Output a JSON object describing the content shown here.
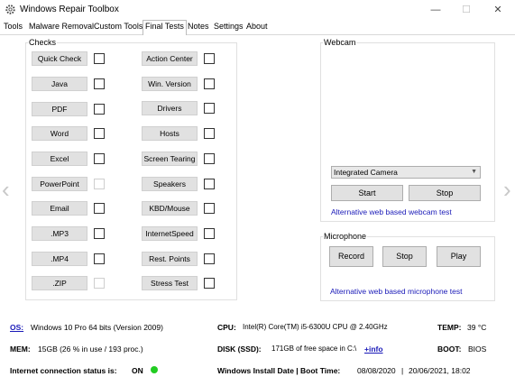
{
  "window": {
    "title": "Windows Repair Toolbox"
  },
  "tabs": [
    "Tools",
    "Malware Removal",
    "Custom Tools",
    "Final Tests",
    "Notes",
    "Settings",
    "About"
  ],
  "checks": {
    "label": "Checks",
    "left": [
      "Quick Check",
      "Java",
      "PDF",
      "Word",
      "Excel",
      "PowerPoint",
      "Email",
      ".MP3",
      ".MP4",
      ".ZIP"
    ],
    "right": [
      "Action Center",
      "Win. Version",
      "Drivers",
      "Hosts",
      "Screen Tearing",
      "Speakers",
      "KBD/Mouse",
      "InternetSpeed",
      "Rest. Points",
      "Stress Test"
    ]
  },
  "webcam": {
    "label": "Webcam",
    "device": "Integrated Camera",
    "start": "Start",
    "stop": "Stop",
    "link": "Alternative web based webcam test"
  },
  "microphone": {
    "label": "Microphone",
    "record": "Record",
    "stop": "Stop",
    "play": "Play",
    "link": "Alternative web based microphone test"
  },
  "sysinfo": {
    "os_label": "OS:",
    "os_value": "Windows 10 Pro 64 bits (Version 2009)",
    "cpu_label": "CPU:",
    "cpu_value": "Intel(R) Core(TM) i5-6300U CPU @ 2.40GHz",
    "temp_label": "TEMP:",
    "temp_value": "39 °C",
    "mem_label": "MEM:",
    "mem_value": "15GB  (26 % in use / 193 proc.)",
    "disk_label": "DISK (SSD):",
    "disk_value": "171GB of free space in C:\\",
    "disk_link": "+info",
    "boot_label": "BOOT:",
    "boot_value": "BIOS",
    "net_label": "Internet connection status is:",
    "net_value": "ON",
    "install_label": "Windows Install Date | Boot Time:",
    "install_value": "08/08/2020",
    "boot_time": "20/06/2021, 18:02"
  },
  "colors": {
    "status_on": "#22cc22",
    "link": "#1a1ab8"
  }
}
